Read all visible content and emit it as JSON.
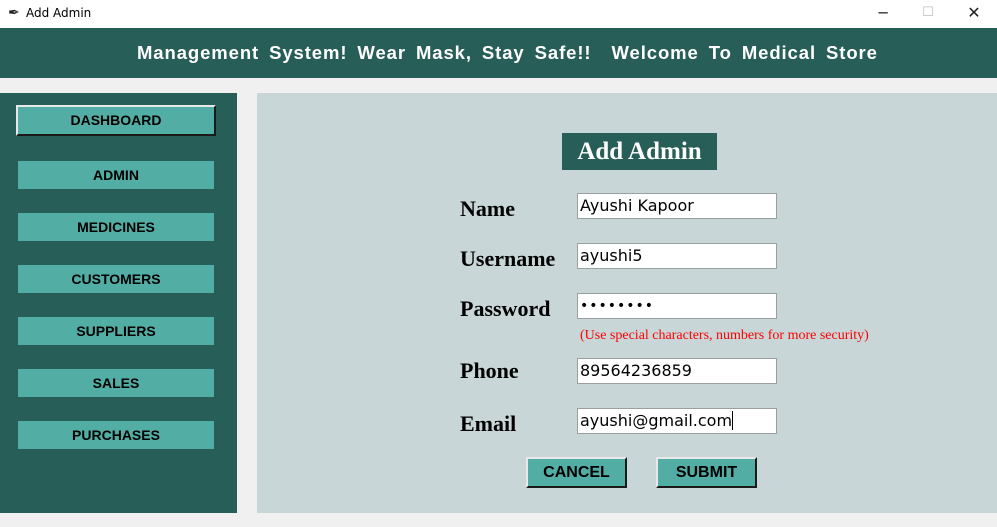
{
  "window": {
    "title": "Add Admin",
    "app_icon": "feather-icon",
    "controls": {
      "minimize": "─",
      "maximize": "☐",
      "close": "✕"
    }
  },
  "header": {
    "marquee": "Management System! Wear Mask, Stay Safe!!  Welcome To Medical Store"
  },
  "sidebar": {
    "items": [
      {
        "label": "DASHBOARD"
      },
      {
        "label": "ADMIN"
      },
      {
        "label": "MEDICINES"
      },
      {
        "label": "CUSTOMERS"
      },
      {
        "label": "SUPPLIERS"
      },
      {
        "label": "SALES"
      },
      {
        "label": "PURCHASES"
      }
    ]
  },
  "form": {
    "title": "Add Admin",
    "fields": {
      "name": {
        "label": "Name",
        "value": "Ayushi Kapoor"
      },
      "username": {
        "label": "Username",
        "value": "ayushi5"
      },
      "password": {
        "label": "Password",
        "value": "••••••••"
      },
      "phone": {
        "label": "Phone",
        "value": "89564236859"
      },
      "email": {
        "label": "Email",
        "value": "ayushi@gmail.com"
      }
    },
    "password_hint": "(Use special characters, numbers for more security)",
    "cancel_label": "CANCEL",
    "submit_label": "SUBMIT"
  },
  "colors": {
    "header_bg": "#285e58",
    "button_bg": "#52aea5",
    "panel_bg": "#c8d6d7",
    "hint": "#ff0000"
  }
}
